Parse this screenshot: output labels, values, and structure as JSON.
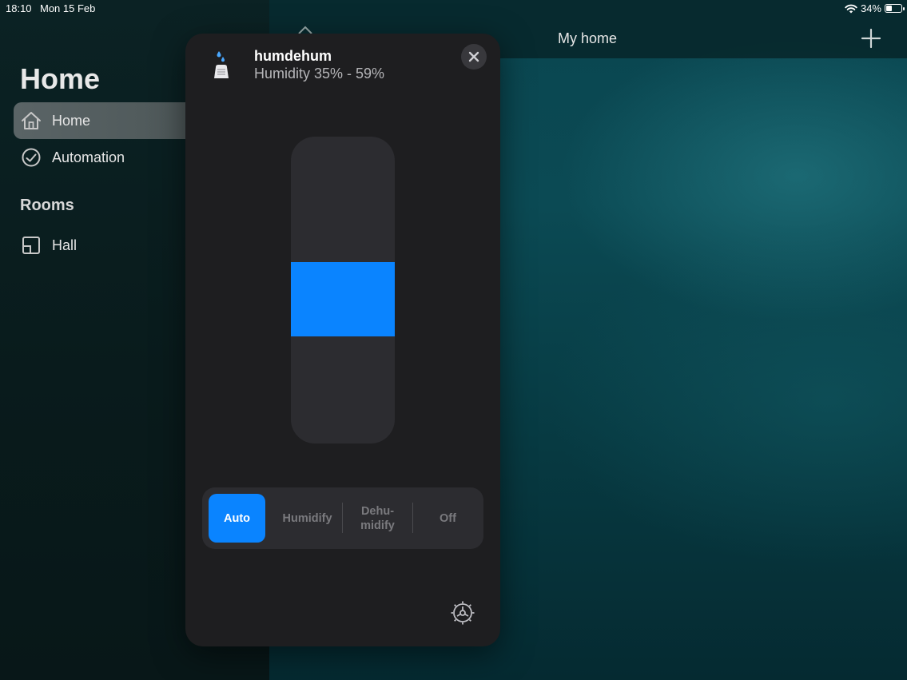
{
  "status_bar": {
    "time": "18:10",
    "date": "Mon 15 Feb",
    "battery": "34%",
    "battery_level": 0.34
  },
  "sidebar": {
    "title": "Home",
    "items": [
      {
        "label": "Home",
        "icon": "house-icon",
        "active": true
      },
      {
        "label": "Automation",
        "icon": "clock-icon",
        "active": false
      }
    ],
    "rooms_heading": "Rooms",
    "rooms": [
      {
        "label": "Hall",
        "icon": "room-icon"
      }
    ]
  },
  "header": {
    "title": "My home",
    "add_icon": "plus-icon"
  },
  "modal": {
    "device_name": "humdehum",
    "device_status": "Humidity 35% - 59%",
    "device_icon": "humidifier-icon",
    "close_icon": "close-icon",
    "humidity_range": {
      "min": 0,
      "max": 100,
      "low": 35,
      "high": 59
    },
    "modes": [
      {
        "label": "Auto",
        "active": true
      },
      {
        "label": "Humidify",
        "active": false
      },
      {
        "label": "Dehu-\nmidify",
        "active": false
      },
      {
        "label": "Off",
        "active": false
      }
    ],
    "settings_icon": "gear-icon"
  },
  "colors": {
    "accent": "#0a84ff",
    "modal_bg": "#1e1e20",
    "track": "#2c2c30"
  }
}
